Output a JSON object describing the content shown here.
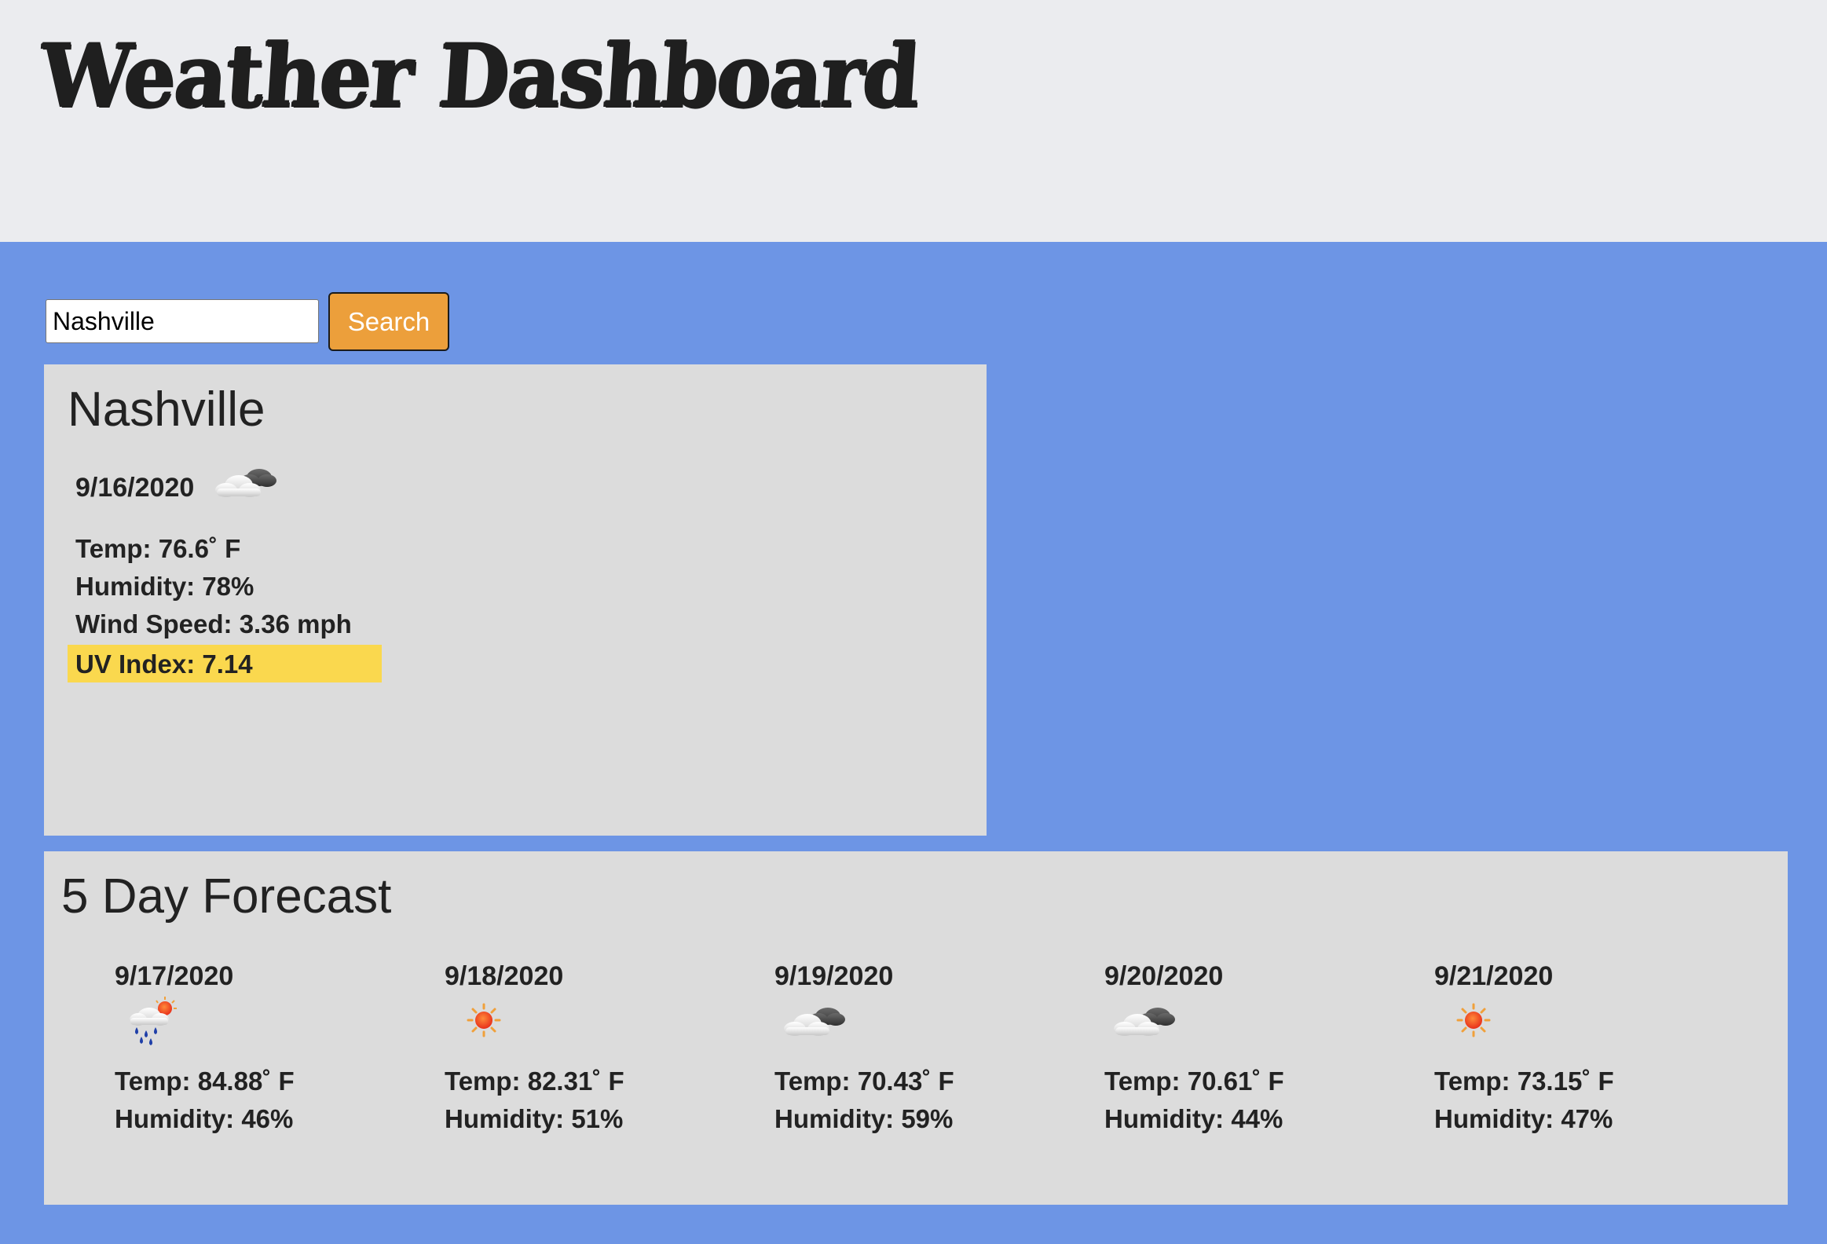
{
  "header": {
    "title": "Weather Dashboard"
  },
  "search": {
    "value": "Nashville",
    "button_label": "Search"
  },
  "current": {
    "city": "Nashville",
    "date": "9/16/2020",
    "icon": "cloudy-icon",
    "temp": "Temp: 76.6˚ F",
    "humidity": "Humidity: 78%",
    "wind": "Wind Speed: 3.36 mph",
    "uv": "UV Index: 7.14",
    "uv_color": "#fad84e"
  },
  "forecast": {
    "title": "5 Day Forecast",
    "days": [
      {
        "date": "9/17/2020",
        "icon": "rain-sun-icon",
        "temp": "Temp: 84.88˚ F",
        "humidity": "Humidity: 46%"
      },
      {
        "date": "9/18/2020",
        "icon": "sun-icon",
        "temp": "Temp: 82.31˚ F",
        "humidity": "Humidity: 51%"
      },
      {
        "date": "9/19/2020",
        "icon": "cloudy-icon",
        "temp": "Temp: 70.43˚ F",
        "humidity": "Humidity: 59%"
      },
      {
        "date": "9/20/2020",
        "icon": "cloudy-icon",
        "temp": "Temp: 70.61˚ F",
        "humidity": "Humidity: 44%"
      },
      {
        "date": "9/21/2020",
        "icon": "sun-icon",
        "temp": "Temp: 73.15˚ F",
        "humidity": "Humidity: 47%"
      }
    ]
  },
  "colors": {
    "header_bg": "#ebecef",
    "main_bg": "#6d95e5",
    "card_bg": "#dcdcdc",
    "search_button": "#ec9f3b"
  }
}
